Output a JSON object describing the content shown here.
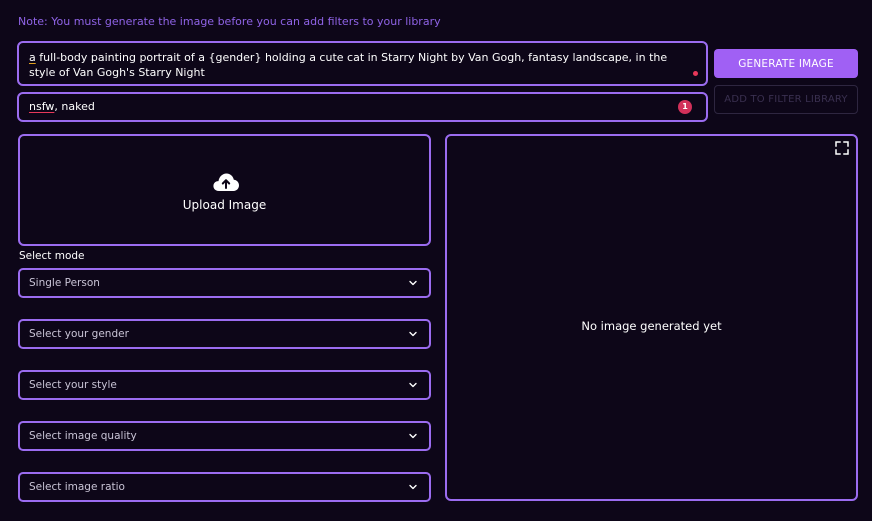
{
  "note": "Note: You must generate the image before you can add filters to your library",
  "prompt": {
    "first_word": "a",
    "rest": " full-body painting portrait of a {gender} holding a cute cat in Starry Night by Van Gogh, fantasy landscape, in the style of Van Gogh's Starry Night"
  },
  "negative_prompt": {
    "first_word": "nsfw",
    "rest": ", naked",
    "badge_count": "1"
  },
  "buttons": {
    "generate": "GENERATE IMAGE",
    "add_filter": "ADD TO FILTER LIBRARY"
  },
  "upload": {
    "label": "Upload Image",
    "icon": "cloud-upload-icon"
  },
  "mode_label": "Select mode",
  "selects": {
    "mode": "Single Person",
    "gender": "Select your gender",
    "style": "Select your style",
    "quality": "Select image quality",
    "ratio": "Select image ratio"
  },
  "preview": {
    "empty_text": "No image generated yet",
    "expand_icon": "fullscreen-icon"
  },
  "colors": {
    "background": "#0d0618",
    "accent_border": "#9b6cf0",
    "primary_button": "#a060f4",
    "note_text": "#8f63e6",
    "badge": "#d2305a"
  }
}
